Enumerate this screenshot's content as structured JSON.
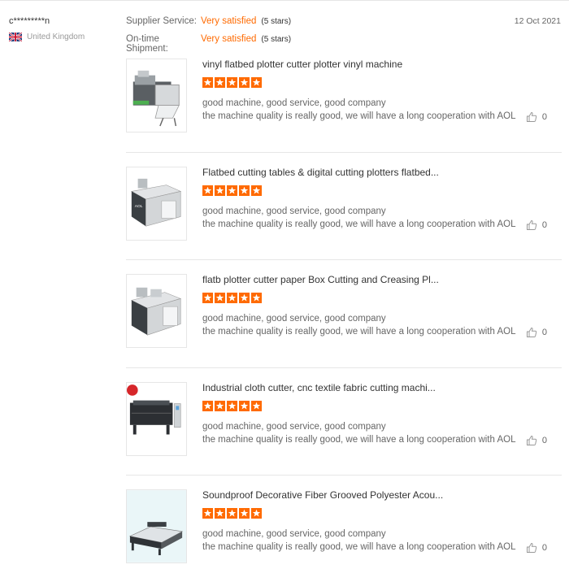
{
  "buyer": {
    "name": "c*********n",
    "country": "United Kingdom",
    "flag_icon": "uk-flag-icon"
  },
  "ratings": [
    {
      "label": "Supplier Service:",
      "value": "Very satisfied",
      "stars_text": "(5 stars)"
    },
    {
      "label": "On-time Shipment:",
      "value": "Very satisfied",
      "stars_text": "(5 stars)"
    }
  ],
  "review_date": "12 Oct 2021",
  "colors": {
    "accent": "#ff6a00",
    "text": "#333333",
    "muted": "#666666",
    "divider": "#e6e6e6"
  },
  "reviews": [
    {
      "title": "vinyl flatbed plotter cutter plotter vinyl machine",
      "rating": 5,
      "line1": "good machine, good service, good company",
      "line2": "the machine quality is really good, we will have a long cooperation with AOL",
      "likes": "0"
    },
    {
      "title": "Flatbed cutting tables & digital cutting plotters flatbed...",
      "rating": 5,
      "line1": "good machine, good service, good company",
      "line2": "the machine quality is really good, we will have a long cooperation with AOL",
      "likes": "0"
    },
    {
      "title": "flatb plotter cutter paper Box Cutting and Creasing Pl...",
      "rating": 5,
      "line1": "good machine, good service, good company",
      "line2": "the machine quality is really good, we will have a long cooperation with AOL",
      "likes": "0"
    },
    {
      "title": "Industrial cloth cutter, cnc textile fabric cutting machi...",
      "rating": 5,
      "line1": "good machine, good service, good company",
      "line2": "the machine quality is really good, we will have a long cooperation with AOL",
      "likes": "0"
    },
    {
      "title": "Soundproof Decorative Fiber Grooved Polyester Acou...",
      "rating": 5,
      "line1": "good machine, good service, good company",
      "line2": "the machine quality is really good, we will have a long cooperation with AOL",
      "likes": "0"
    }
  ]
}
